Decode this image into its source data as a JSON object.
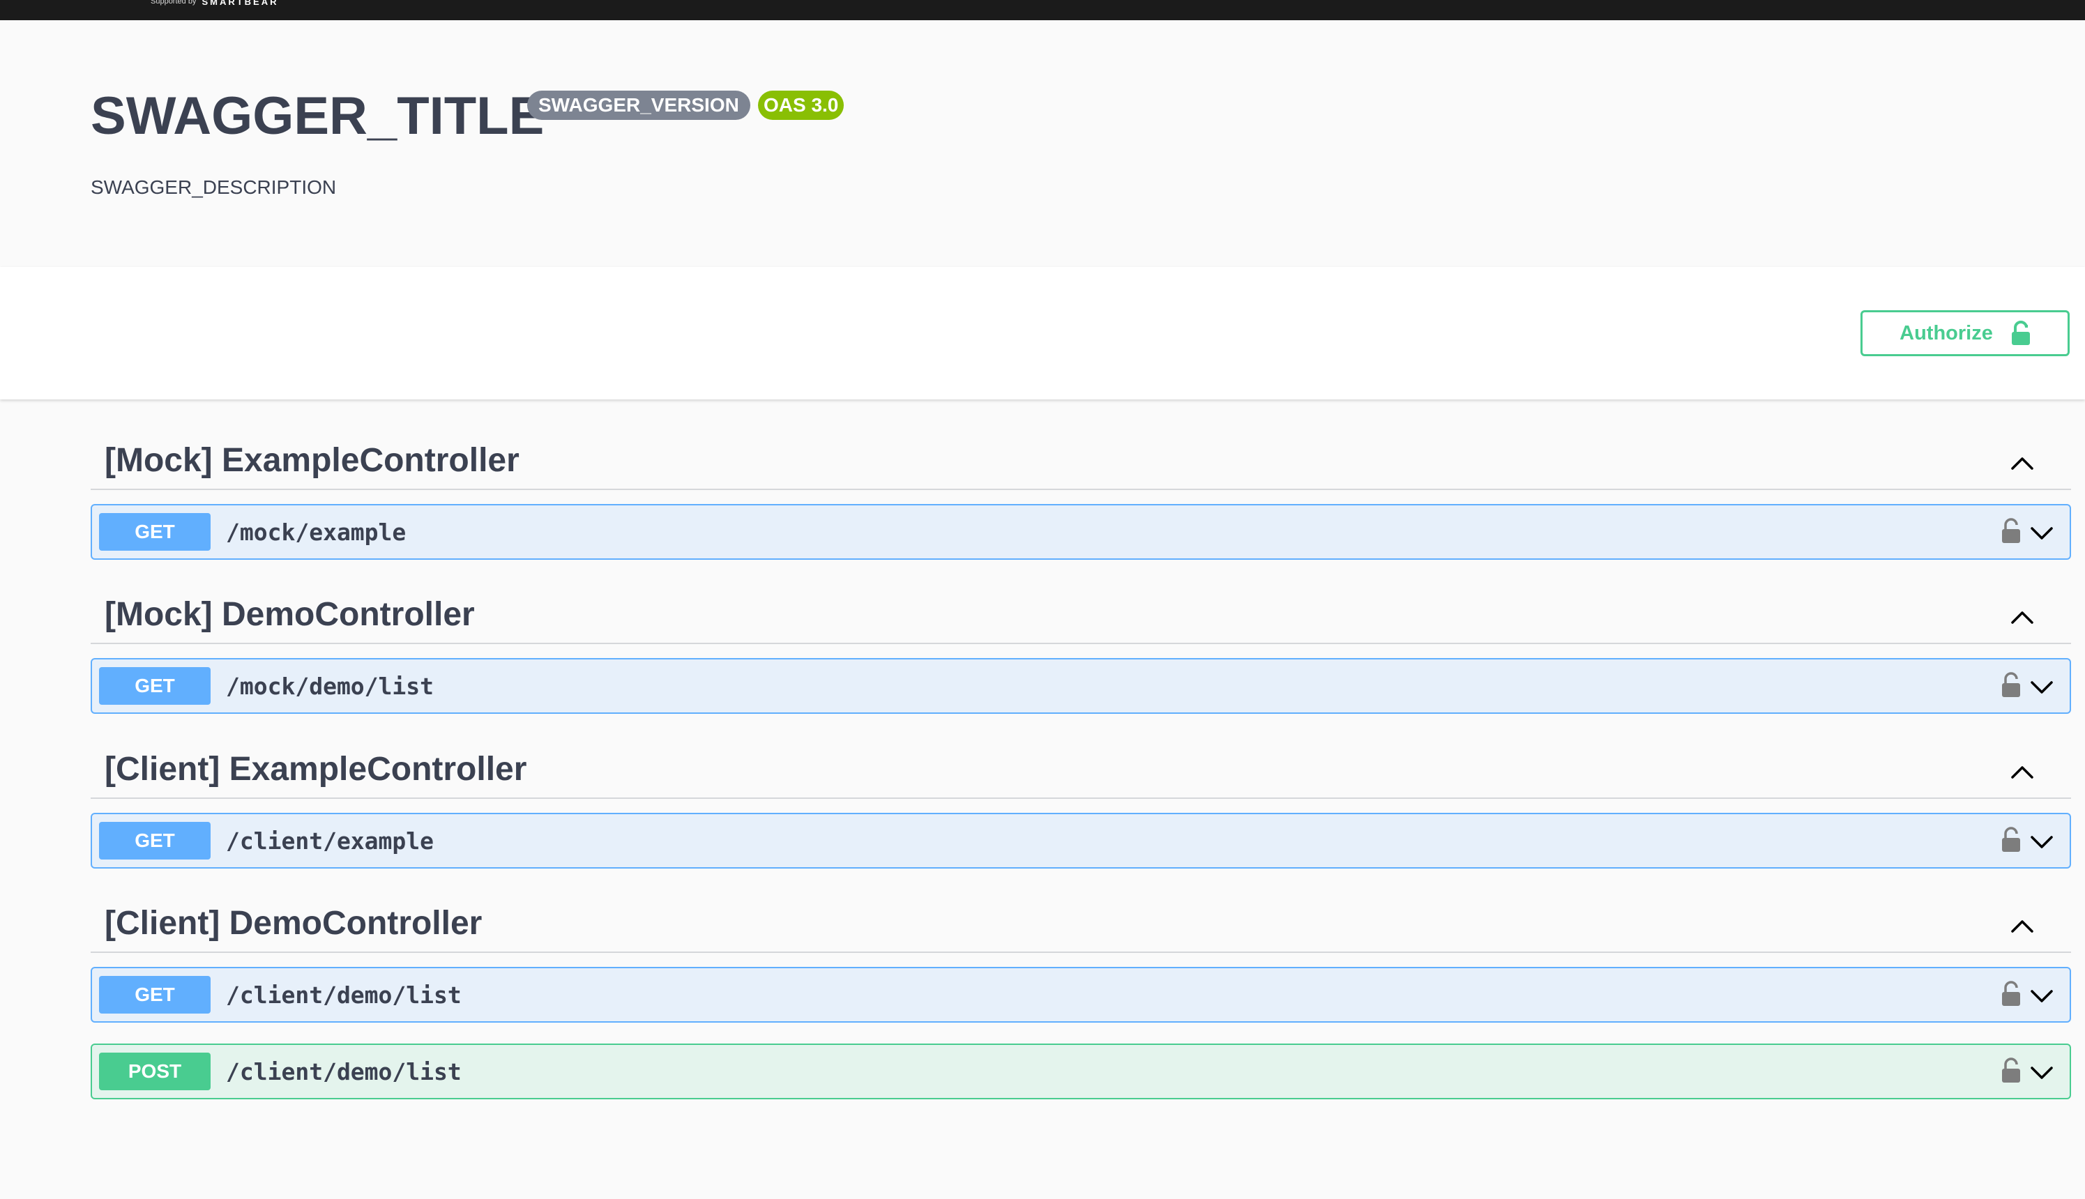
{
  "topbar": {
    "supported_by": "Supported by",
    "brand": "SMARTBEAR"
  },
  "info": {
    "title": "SWAGGER_TITLE",
    "version": "SWAGGER_VERSION",
    "oas": "OAS 3.0",
    "description": "SWAGGER_DESCRIPTION"
  },
  "authorize": {
    "label": "Authorize",
    "icon": "unlocked-lock-icon"
  },
  "tags": [
    {
      "name": "[Mock] ExampleController",
      "operations": [
        {
          "method": "GET",
          "path": "/mock/example"
        }
      ]
    },
    {
      "name": "[Mock] DemoController",
      "operations": [
        {
          "method": "GET",
          "path": "/mock/demo/list"
        }
      ]
    },
    {
      "name": "[Client] ExampleController",
      "operations": [
        {
          "method": "GET",
          "path": "/client/example"
        }
      ]
    },
    {
      "name": "[Client] DemoController",
      "operations": [
        {
          "method": "GET",
          "path": "/client/demo/list"
        },
        {
          "method": "POST",
          "path": "/client/demo/list"
        }
      ]
    }
  ],
  "colors": {
    "get": "#61afe",
    "post": "#49cc90",
    "authorize": "#49cc90",
    "oas_badge": "#89bf04",
    "version_badge": "#7d8492",
    "text": "#3b4151"
  }
}
